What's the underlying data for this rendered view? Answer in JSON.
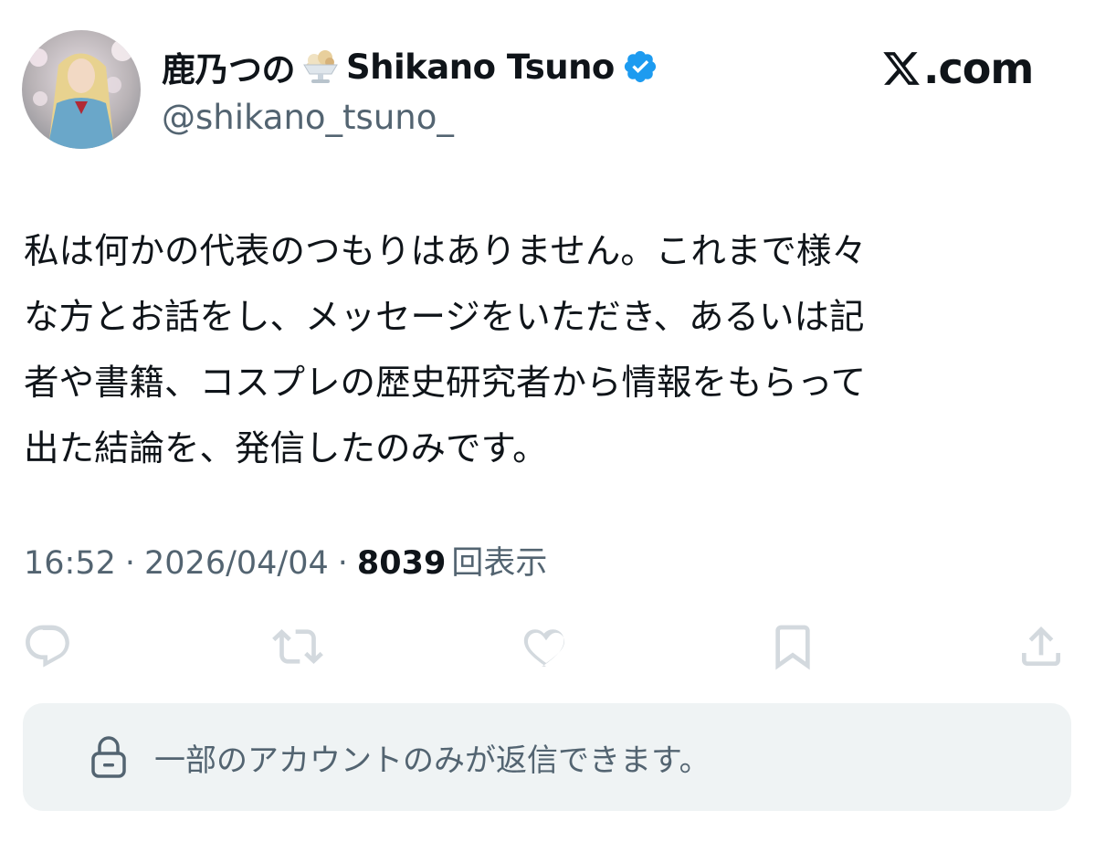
{
  "author": {
    "display_name": "鹿乃つの",
    "display_name_en": "Shikano Tsuno",
    "handle": "@shikano_tsuno_",
    "emoji": "shaved-ice-icon",
    "verified_icon": "verified-badge-icon"
  },
  "brand": {
    "logo_text": ".com",
    "logo_icon": "x-logo-icon"
  },
  "tweet": {
    "lines": [
      "私は何かの代表のつもりはありません。これまで様々",
      "な方とお話をし、メッセージをいただき、あるいは記",
      "者や書籍、コスプレの歴史研究者から情報をもらって",
      "出た結論を、発信したのみです。"
    ]
  },
  "meta": {
    "time": "16:52",
    "separator": "·",
    "date": "2026/04/04",
    "views_count": "8039",
    "views_label": "回表示"
  },
  "actions": [
    {
      "name": "reply",
      "icon": "reply-icon"
    },
    {
      "name": "retweet",
      "icon": "retweet-icon"
    },
    {
      "name": "like",
      "icon": "heart-icon"
    },
    {
      "name": "bookmark",
      "icon": "bookmark-icon"
    },
    {
      "name": "share",
      "icon": "share-icon"
    }
  ],
  "reply_restriction": {
    "icon": "lock-icon",
    "text": "一部のアカウントのみが返信できます。"
  },
  "colors": {
    "text_primary": "#0f1419",
    "text_secondary": "#536471",
    "icon_gray": "#d3d9de",
    "verified_blue": "#1d9bf0",
    "reply_bar_bg": "#eff3f4"
  }
}
